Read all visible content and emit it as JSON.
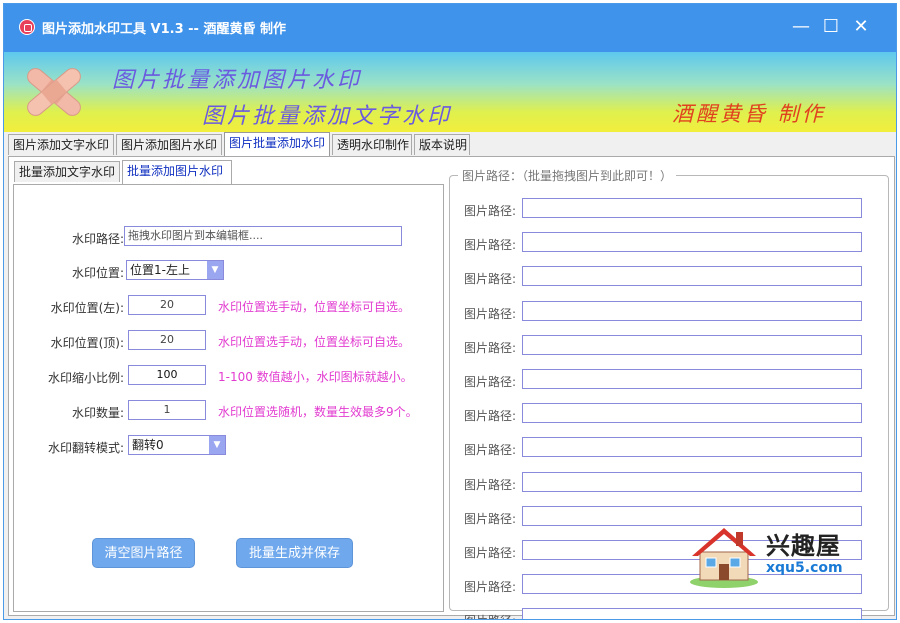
{
  "window": {
    "title": "图片添加水印工具 V1.3 -- 酒醒黄昏 制作",
    "minimize_glyph": "—",
    "maximize_glyph": "☐",
    "close_glyph": "✕"
  },
  "banner": {
    "line1": "图片批量添加图片水印",
    "line2": "图片批量添加文字水印",
    "author": "酒醒黄昏 制作"
  },
  "tabs": [
    {
      "label": "图片添加文字水印"
    },
    {
      "label": "图片添加图片水印"
    },
    {
      "label": "图片批量添加水印"
    },
    {
      "label": "透明水印制作"
    },
    {
      "label": "版本说明"
    }
  ],
  "subtabs": [
    {
      "label": "批量添加文字水印"
    },
    {
      "label": "批量添加图片水印"
    }
  ],
  "form": {
    "path_label": "水印路径:",
    "path_value": "拖拽水印图片到本编辑框....",
    "position_label": "水印位置:",
    "position_value": "位置1-左上",
    "left_label": "水印位置(左):",
    "left_value": "20",
    "left_hint": "水印位置选手动，位置坐标可自选。",
    "top_label": "水印位置(顶):",
    "top_value": "20",
    "top_hint": "水印位置选手动，位置坐标可自选。",
    "scale_label": "水印缩小比例:",
    "scale_value": "100",
    "scale_hint": "1-100 数值越小，水印图标就越小。",
    "count_label": "水印数量:",
    "count_value": "1",
    "count_hint": "水印位置选随机，数量生效最多9个。",
    "flip_label": "水印翻转模式:",
    "flip_value": "翻转0"
  },
  "buttons": {
    "clear": "清空图片路径",
    "generate": "批量生成并保存"
  },
  "paths": {
    "group_title": "图片路径：（批量拖拽图片到此即可！）",
    "rows": [
      "图片路径:",
      "图片路径:",
      "图片路径:",
      "图片路径:",
      "图片路径:",
      "图片路径:",
      "图片路径:",
      "图片路径:",
      "图片路径:",
      "图片路径:",
      "图片路径:",
      "图片路径:",
      "图片路径:"
    ]
  },
  "watermark_logo": {
    "brand": "兴趣屋",
    "site": "xqu5.com"
  },
  "colors": {
    "titlebar": "#3f93ea",
    "hint": "#e23bd0",
    "button": "#6fa8ec",
    "active_tab_text": "#1030c0",
    "banner_text": "#6a5ae0",
    "author_text": "#e0421f"
  }
}
